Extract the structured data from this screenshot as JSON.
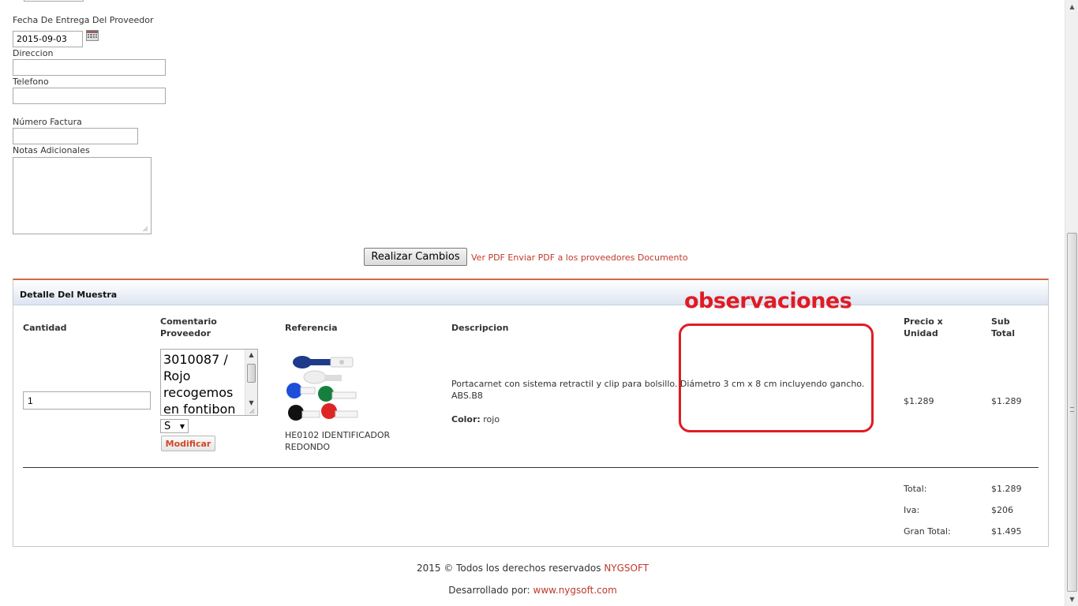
{
  "form": {
    "fecha_label": "Fecha De Entrega Del Proveedor",
    "fecha_value": "2015-09-03",
    "direccion_label": "Direccion",
    "direccion_value": "",
    "telefono_label": "Telefono",
    "telefono_value": "",
    "factura_label": "Número Factura",
    "factura_value": "",
    "notas_label": "Notas Adicionales",
    "notas_value": ""
  },
  "actions": {
    "realizar_cambios": "Realizar Cambios",
    "ver_pdf": "Ver PDF",
    "enviar_pdf": "Enviar PDF a los proveedores",
    "documento": "Documento"
  },
  "detail": {
    "title": "Detalle Del Muestra",
    "headers": {
      "cantidad": "Cantidad",
      "comentario_1": "Comentario",
      "comentario_2": "Proveedor",
      "referencia": "Referencia",
      "descripcion": "Descripcion",
      "precio_1": "Precio x",
      "precio_2": "Unidad",
      "sub_1": "Sub",
      "sub_2": "Total"
    },
    "row": {
      "cantidad": "1",
      "comentario": "3010087 / Rojo recogemos en fontibon",
      "talla": "S",
      "modificar": "Modificar",
      "ref_code": "HE0102 IDENTIFICADOR",
      "ref_code_2": "REDONDO",
      "descripcion": "Portacarnet con sistema retractil y clip para bolsillo. Diámetro 3 cm x 8 cm incluyendo gancho.",
      "descripcion_2": "ABS.B8",
      "color_label": "Color:",
      "color_value": "rojo",
      "precio": "$1.289",
      "subtotal": "$1.289"
    },
    "totals": {
      "total_label": "Total:",
      "total_value": "$1.289",
      "iva_label": "Iva:",
      "iva_value": "$206",
      "gran_label": "Gran Total:",
      "gran_value": "$1.495"
    }
  },
  "annotation": {
    "text": "observaciones",
    "color": "#e01b24"
  },
  "footer": {
    "copyright": "2015 © Todos los derechos reservados",
    "brand": "NYGSOFT",
    "dev_label": "Desarrollado por:",
    "dev_link": "www.nygsoft.com"
  },
  "colors": {
    "accent": "#c0392b",
    "panel_border_top": "#d06a4a",
    "header_gradient_bottom": "#dde5f1"
  }
}
